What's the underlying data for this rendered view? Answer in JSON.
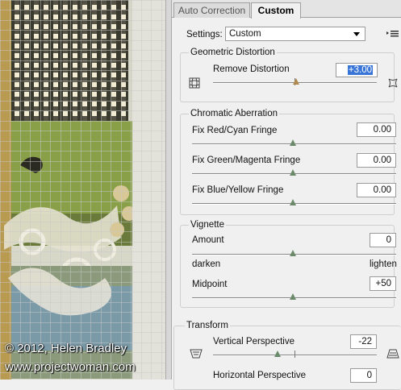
{
  "tabs": [
    {
      "label": "Auto Correction"
    },
    {
      "label": "Custom"
    }
  ],
  "settings": {
    "label": "Settings:",
    "value": "Custom"
  },
  "geometric": {
    "header": "Geometric Distortion",
    "remove_label": "Remove Distortion",
    "remove_value": "+3.00"
  },
  "chromatic": {
    "header": "Chromatic Aberration",
    "red_cyan_label": "Fix Red/Cyan Fringe",
    "red_cyan_value": "0.00",
    "green_magenta_label": "Fix Green/Magenta Fringe",
    "green_magenta_value": "0.00",
    "blue_yellow_label": "Fix Blue/Yellow Fringe",
    "blue_yellow_value": "0.00"
  },
  "vignette": {
    "header": "Vignette",
    "amount_label": "Amount",
    "amount_value": "0",
    "darken_label": "darken",
    "lighten_label": "lighten",
    "midpoint_label": "Midpoint",
    "midpoint_value": "+50"
  },
  "transform": {
    "header": "Transform",
    "vertical_label": "Vertical Perspective",
    "vertical_value": "-22",
    "horizontal_label": "Horizontal Perspective",
    "horizontal_value": "0"
  },
  "credits": {
    "line1": "© 2012, Helen Bradley",
    "line2": "www.projectwoman.com"
  },
  "colors": {
    "selection": "#3875d7",
    "panel_bg": "#f0f0f0"
  }
}
